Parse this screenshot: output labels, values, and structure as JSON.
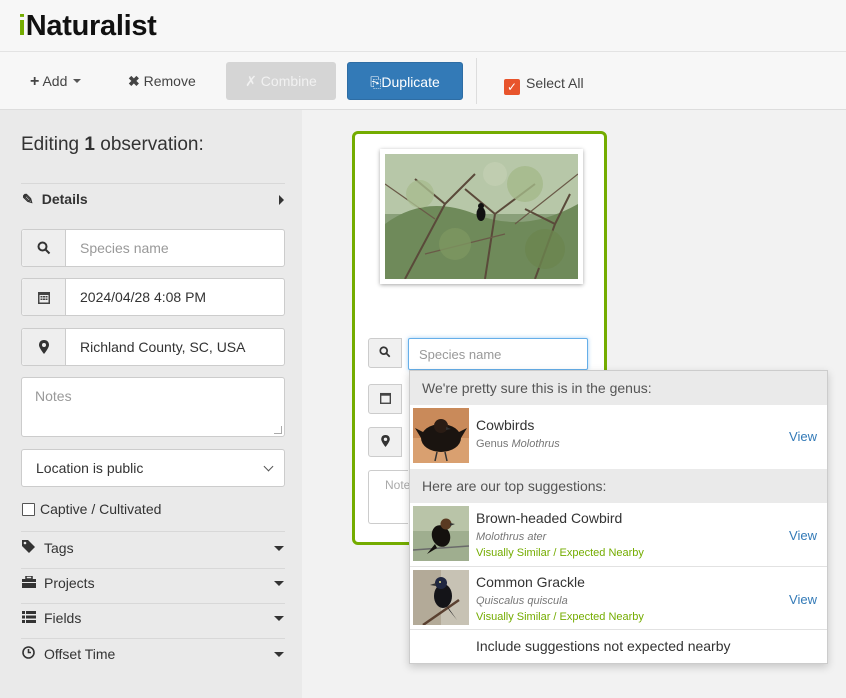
{
  "app": {
    "logo_i": "i",
    "logo_rest": "Naturalist"
  },
  "toolbar": {
    "add_label": "Add",
    "remove_label": "Remove",
    "combine_label": "Combine",
    "duplicate_label": "Duplicate",
    "select_all_label": "Select All"
  },
  "sidebar": {
    "editing_prefix": "Editing",
    "editing_count": "1",
    "editing_suffix": "observation:",
    "details_label": "Details",
    "species_placeholder": "Species name",
    "date_value": "2024/04/28 4:08 PM",
    "location_value": "Richland County, SC, USA",
    "notes_placeholder": "Notes",
    "location_privacy": "Location is public",
    "captive_label": "Captive / Cultivated",
    "sections": [
      {
        "label": "Tags",
        "icon": "tag-icon"
      },
      {
        "label": "Projects",
        "icon": "briefcase-icon"
      },
      {
        "label": "Fields",
        "icon": "list-icon"
      },
      {
        "label": "Offset Time",
        "icon": "clock-icon"
      }
    ]
  },
  "card": {
    "species_placeholder": "Species name",
    "notes_placeholder": "Notes"
  },
  "suggestions": {
    "genus_header": "We're pretty sure this is in the genus:",
    "genus": {
      "name": "Cowbirds",
      "rank": "Genus",
      "scientific": "Molothrus",
      "view": "View"
    },
    "top_header": "Here are our top suggestions:",
    "items": [
      {
        "name": "Brown-headed Cowbird",
        "scientific": "Molothrus ater",
        "tag": "Visually Similar / Expected Nearby",
        "view": "View"
      },
      {
        "name": "Common Grackle",
        "scientific": "Quiscalus quiscula",
        "tag": "Visually Similar / Expected Nearby",
        "view": "View"
      }
    ],
    "footer": "Include suggestions not expected nearby"
  },
  "colors": {
    "brand_green": "#74ac00",
    "duplicate_blue": "#337ab7",
    "select_all_orange": "#e8542c"
  }
}
